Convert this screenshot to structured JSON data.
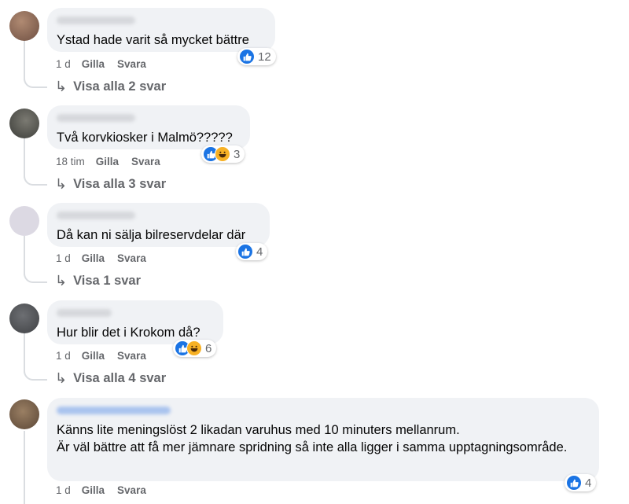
{
  "comments": [
    {
      "text": "Ystad hade varit så mycket bättre",
      "time": "1 d",
      "like_label": "Gilla",
      "reply_label": "Svara",
      "reaction_count": "12",
      "show_replies": "Visa alla 2 svar",
      "avatar_color": "#8a6a5a"
    },
    {
      "text": "Två korvkiosker i Malmö?????",
      "time": "18 tim",
      "like_label": "Gilla",
      "reply_label": "Svara",
      "reaction_count": "3",
      "show_replies": "Visa alla 3 svar",
      "avatar_color": "#4d4d48"
    },
    {
      "text": "Då kan ni sälja bilreservdelar där",
      "time": "1 d",
      "like_label": "Gilla",
      "reply_label": "Svara",
      "reaction_count": "4",
      "show_replies": "Visa 1 svar",
      "avatar_color": "#d9d6e2"
    },
    {
      "text": "Hur blir det i Krokom då?",
      "time": "1 d",
      "like_label": "Gilla",
      "reply_label": "Svara",
      "reaction_count": "6",
      "show_replies": "Visa alla 4 svar",
      "avatar_color": "#595b5e"
    },
    {
      "text": "Känns lite meningslöst 2 likadan varuhus med 10 minuters mellanrum.\nÄr väl bättre att få mer jämnare spridning så inte alla ligger i samma upptagningsområde.",
      "time": "1 d",
      "like_label": "Gilla",
      "reply_label": "Svara",
      "reaction_count": "4",
      "avatar_color": "#7a6650"
    }
  ],
  "colors": {
    "like_blue": "#1b74e4",
    "haha_yellow": "#f7b125",
    "bubble_bg": "#f0f2f5",
    "meta_gray": "#65676b"
  },
  "icons": {
    "like": "like-icon",
    "haha": "haha-icon",
    "reply_arrow": "reply-arrow-icon"
  }
}
